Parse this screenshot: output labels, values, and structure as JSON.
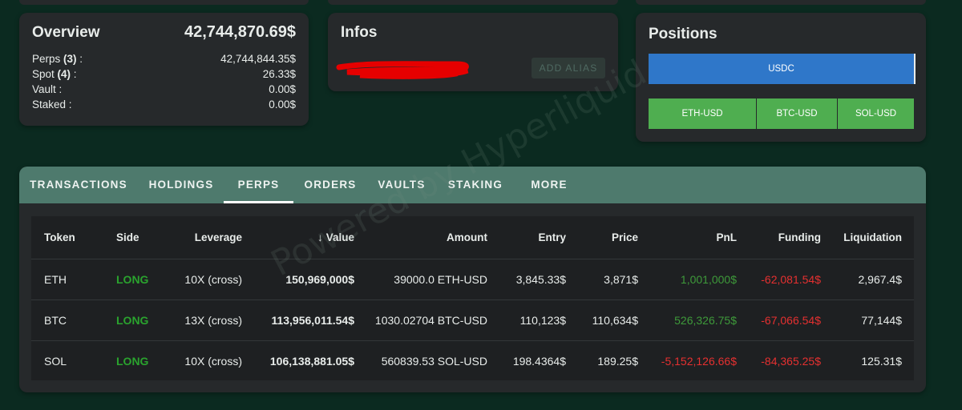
{
  "overview": {
    "title": "Overview",
    "total": "42,744,870.69$",
    "rows": [
      {
        "label_prefix": "Perps ",
        "count": "(3)",
        "label_suffix": " :",
        "value": "42,744,844.35$"
      },
      {
        "label_prefix": "Spot ",
        "count": "(4)",
        "label_suffix": " :",
        "value": "26.33$"
      },
      {
        "label_prefix": "Vault :",
        "count": "",
        "label_suffix": "",
        "value": "0.00$"
      },
      {
        "label_prefix": "Staked :",
        "count": "",
        "label_suffix": "",
        "value": "0.00$"
      }
    ]
  },
  "infos": {
    "title": "Infos",
    "add_alias": "ADD ALIAS"
  },
  "positions": {
    "title": "Positions",
    "spot_bar": "USDC",
    "perp_buttons": [
      "ETH-USD",
      "BTC-USD",
      "SOL-USD"
    ]
  },
  "tabs": [
    "TRANSACTIONS",
    "HOLDINGS",
    "PERPS",
    "ORDERS",
    "VAULTS",
    "STAKING",
    "MORE"
  ],
  "active_tab": "PERPS",
  "table": {
    "headers": {
      "token": "Token",
      "side": "Side",
      "leverage": "Leverage",
      "value": "Value",
      "amount": "Amount",
      "entry": "Entry",
      "price": "Price",
      "pnl": "PnL",
      "funding": "Funding",
      "liquidation": "Liquidation"
    },
    "sort_arrow": "↓",
    "rows": [
      {
        "token": "ETH",
        "side": "LONG",
        "leverage": "10X (cross)",
        "value": "150,969,000$",
        "amount": "39000.0 ETH-USD",
        "entry": "3,845.33$",
        "price": "3,871$",
        "pnl": "1,001,000$",
        "funding": "-62,081.54$",
        "liquidation": "2,967.4$"
      },
      {
        "token": "BTC",
        "side": "LONG",
        "leverage": "13X (cross)",
        "value": "113,956,011.54$",
        "amount": "1030.02704 BTC-USD",
        "entry": "110,123$",
        "price": "110,634$",
        "pnl": "526,326.75$",
        "funding": "-67,066.54$",
        "liquidation": "77,144$"
      },
      {
        "token": "SOL",
        "side": "LONG",
        "leverage": "10X (cross)",
        "value": "106,138,881.05$",
        "amount": "560839.53 SOL-USD",
        "entry": "198.4364$",
        "price": "189.25$",
        "pnl": "-5,152,126.66$",
        "funding": "-84,365.25$",
        "liquidation": "125.31$"
      }
    ]
  },
  "watermark": "Powered by Hyperliquid",
  "colors": {
    "background": "#0b2a20",
    "card": "#26292b",
    "tabbar": "#4e7a6d",
    "usdc": "#2f77c9",
    "perp_button": "#4fae50",
    "long": "#2aa32e",
    "profit": "#3e9a3a",
    "loss": "#e53030",
    "redaction": "#e60000"
  }
}
